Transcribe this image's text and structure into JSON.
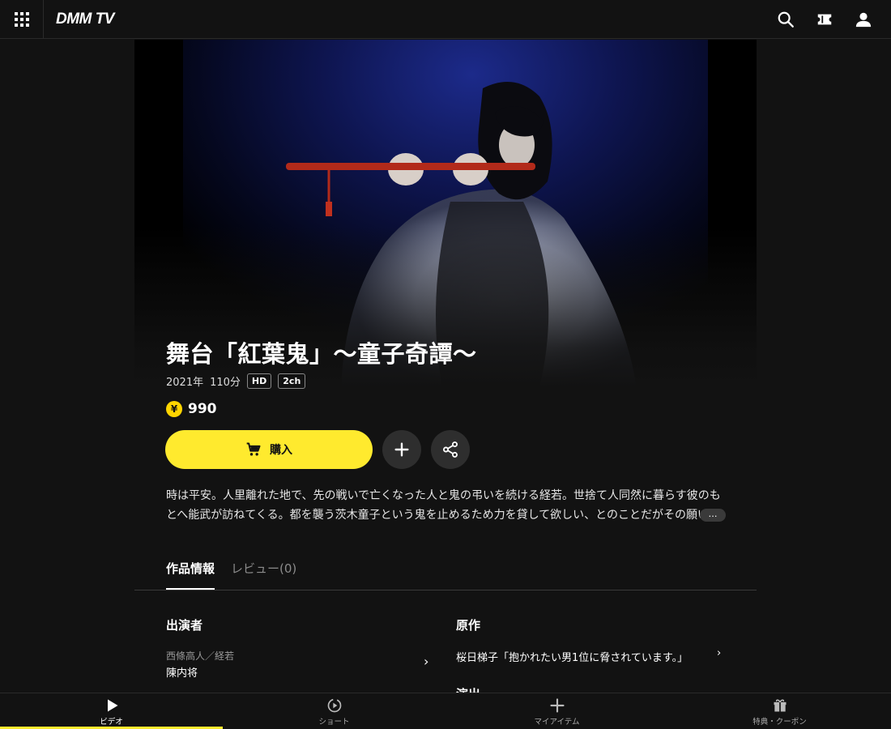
{
  "header": {
    "logo": "DMM TV",
    "icons": [
      "apps-grid-icon",
      "search-icon",
      "ticket-icon",
      "account-icon"
    ]
  },
  "content": {
    "title": "舞台「紅葉鬼」～童子奇譚～",
    "year": "2021年",
    "duration": "110分",
    "badges": [
      "HD",
      "2ch"
    ],
    "price_symbol": "¥",
    "price": "990",
    "buy_label": "購入",
    "description": "時は平安。人里離れた地で、先の戦いで亡くなった人と鬼の弔いを続ける経若。世捨て人同然に暮らす彼のもとへ能武が訪ねてくる。都を襲う茨木童子という鬼を止めるため力を貸して欲しい、とのことだがその願いに経若は",
    "more_label": "…"
  },
  "tabs": [
    {
      "label": "作品情報",
      "active": true
    },
    {
      "label": "レビュー(0)",
      "active": false
    }
  ],
  "details": {
    "cast_title": "出演者",
    "cast_role": "西條高人／経若",
    "cast_name": "陳内将",
    "original_title": "原作",
    "original_value": "桜日梯子「抱かれたい男1位に脅されています。」",
    "next_section_peek": "演出"
  },
  "bottom_nav": [
    {
      "label": "ビデオ",
      "icon": "play-icon",
      "active": true
    },
    {
      "label": "ショート",
      "icon": "short-play-icon",
      "active": false
    },
    {
      "label": "マイアイテム",
      "icon": "plus-icon",
      "active": false
    },
    {
      "label": "特典・クーポン",
      "icon": "gift-icon",
      "active": false
    }
  ],
  "colors": {
    "accent": "#ffea2e",
    "background": "#121212",
    "coin": "#ffd500"
  }
}
